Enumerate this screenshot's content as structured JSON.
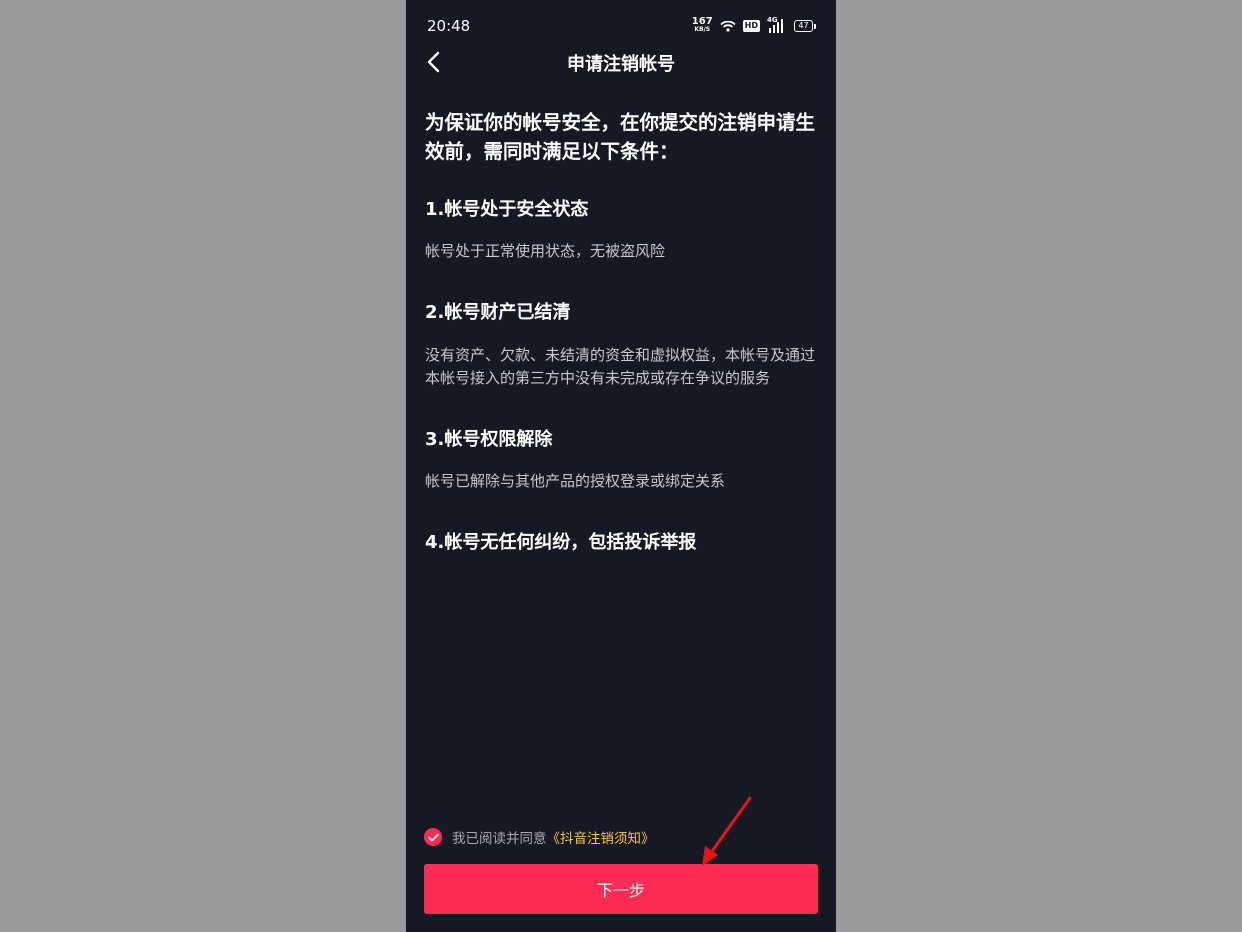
{
  "status_bar": {
    "time": "20:48",
    "net_speed": "167",
    "net_unit": "KB/S",
    "hd_badge": "HD",
    "network_type": "4G",
    "battery": "47"
  },
  "nav": {
    "title": "申请注销帐号"
  },
  "intro": "为保证你的帐号安全，在你提交的注销申请生效前，需同时满足以下条件：",
  "conditions": [
    {
      "title": "1.帐号处于安全状态",
      "desc": "帐号处于正常使用状态，无被盗风险"
    },
    {
      "title": "2.帐号财产已结清",
      "desc": "没有资产、欠款、未结清的资金和虚拟权益，本帐号及通过本帐号接入的第三方中没有未完成或存在争议的服务"
    },
    {
      "title": "3.帐号权限解除",
      "desc": "帐号已解除与其他产品的授权登录或绑定关系"
    },
    {
      "title": "4.帐号无任何纠纷，包括投诉举报"
    }
  ],
  "agreement": {
    "text": "我已阅读并同意",
    "link": "《抖音注销须知》",
    "checked": true
  },
  "next_button": "下一步",
  "colors": {
    "background": "#161823",
    "accent": "#fe2c55",
    "link": "#f5c344",
    "annotation_arrow": "#e8141b"
  }
}
